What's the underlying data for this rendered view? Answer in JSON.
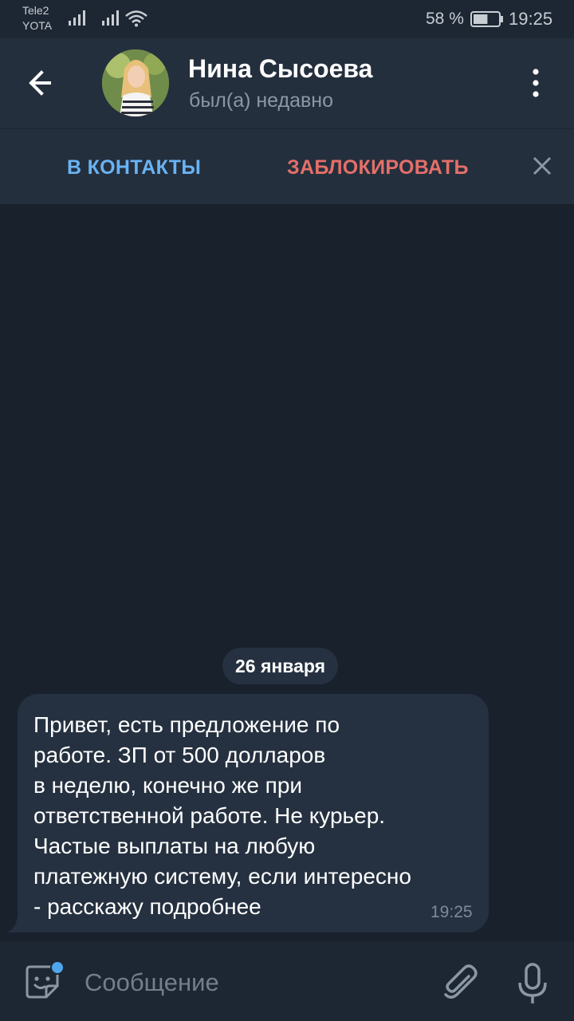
{
  "status_bar": {
    "carrier_1": "Tele2",
    "carrier_2": "YOTA",
    "battery_percent": "58 %",
    "battery_level": 0.58,
    "time": "19:25"
  },
  "header": {
    "contact_name": "Нина Сысоева",
    "contact_status": "был(а) недавно",
    "back_icon": "arrow-left-icon",
    "menu_icon": "more-vertical-icon"
  },
  "action_bar": {
    "add_contact_label": "В КОНТАКТЫ",
    "block_label": "ЗАБЛОКИРОВАТЬ",
    "close_icon": "close-icon"
  },
  "chat": {
    "date_label": "26 января",
    "messages": [
      {
        "text": "Привет, есть предложение по\nработе. ЗП от 500 долларов\nв неделю, конечно же при\nответственной работе. Не курьер.\nЧастые выплаты на любую\nплатежную систему, если интересно\n- расскажу подробнее",
        "time": "19:25"
      }
    ]
  },
  "composer": {
    "placeholder": "Сообщение",
    "value": "",
    "sticker_icon": "sticker-icon",
    "attach_icon": "paperclip-icon",
    "mic_icon": "microphone-icon"
  },
  "colors": {
    "header_bg": "#242f3d",
    "chat_bg": "#18212c",
    "bubble_bg": "#253140",
    "accent_blue": "#6ab3f3",
    "accent_red": "#e56f69",
    "unread_dot": "#4fa6ec"
  }
}
